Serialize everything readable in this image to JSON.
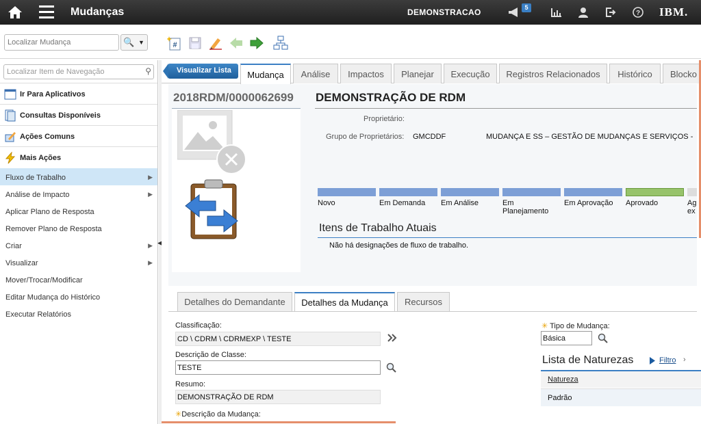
{
  "topbar": {
    "app_title": "Mudanças",
    "user_label": "DEMONSTRACAO",
    "notification_count": "5",
    "brand": "IBM."
  },
  "toolbar": {
    "search_placeholder": "Localizar Mudança"
  },
  "sidebar": {
    "search_placeholder": "Localizar Item de Navegação",
    "sections": [
      {
        "label": "Ir Para Aplicativos",
        "icon": "apps-icon"
      },
      {
        "label": "Consultas Disponíveis",
        "icon": "queries-icon"
      },
      {
        "label": "Ações Comuns",
        "icon": "common-actions-icon"
      },
      {
        "label": "Mais Ações",
        "icon": "more-actions-icon"
      }
    ],
    "items": [
      {
        "label": "Fluxo de Trabalho",
        "submenu": true,
        "active": true
      },
      {
        "label": "Análise de Impacto",
        "submenu": true
      },
      {
        "label": "Aplicar Plano de Resposta",
        "submenu": false
      },
      {
        "label": "Remover Plano de Resposta",
        "submenu": false
      },
      {
        "label": "Criar",
        "submenu": true
      },
      {
        "label": "Visualizar",
        "submenu": true
      },
      {
        "label": "Mover/Trocar/Modificar",
        "submenu": false
      },
      {
        "label": "Editar Mudança do Histórico",
        "submenu": false
      },
      {
        "label": "Executar Relatórios",
        "submenu": false
      }
    ]
  },
  "tabs": {
    "back_label": "Visualizar Lista",
    "items": [
      "Mudança",
      "Análise",
      "Impactos",
      "Planejar",
      "Execução",
      "Registros Relacionados",
      "Histórico",
      "Blocko"
    ]
  },
  "record": {
    "id": "2018RDM/0000062699",
    "title": "DEMONSTRAÇÃO DE RDM",
    "owner_label": "Proprietário:",
    "owner_group_label": "Grupo de Proprietários:",
    "owner_group_code": "GMCDDF",
    "owner_group_desc": "MUDANÇA E SS – GESTÃO DE MUDANÇAS E SERVIÇOS -"
  },
  "stages": [
    {
      "label": "Novo",
      "state": "done"
    },
    {
      "label": "Em Demanda",
      "state": "done"
    },
    {
      "label": "Em Análise",
      "state": "done"
    },
    {
      "label": "Em Planejamento",
      "state": "done"
    },
    {
      "label": "Em Aprovação",
      "state": "done"
    },
    {
      "label": "Aprovado",
      "state": "current"
    },
    {
      "label": "Ag ex",
      "state": "pending"
    }
  ],
  "work_items": {
    "title": "Itens de Trabalho Atuais",
    "message": "Não há designações de fluxo de trabalho."
  },
  "subtabs": [
    "Detalhes do Demandante",
    "Detalhes da Mudança",
    "Recursos"
  ],
  "details": {
    "classification_label": "Classificação:",
    "classification_value": "CD \\ CDRM \\ CDRMEXP \\ TESTE",
    "class_desc_label": "Descrição de Classe:",
    "class_desc_value": "TESTE",
    "summary_label": "Resumo:",
    "summary_value": "DEMONSTRAÇÃO DE RDM",
    "change_desc_label": "Descrição da Mudança:",
    "change_type_label": "Tipo de Mudança:",
    "change_type_value": "Básica"
  },
  "natures": {
    "title": "Lista de Naturezas",
    "filter_label": "Filtro",
    "column_header": "Natureza",
    "rows": [
      "Padrão"
    ]
  },
  "colors": {
    "accent": "#3b7fc4",
    "stage_done": "#7d9fd6",
    "stage_current": "#97c36b",
    "active_nav": "#cfe6f7"
  }
}
